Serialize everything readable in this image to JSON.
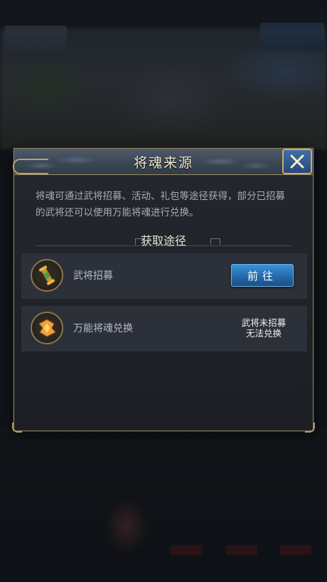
{
  "dialog": {
    "title": "将魂来源",
    "description": "将魂可通过武将招募、活动、礼包等途径获得，部分已招募的武将还可以使用万能将魂进行兑换。",
    "section_title": "获取途径",
    "sources": [
      {
        "label": "武将招募",
        "icon": "scroll-icon",
        "action_label": "前往"
      },
      {
        "label": "万能将魂兑换",
        "icon": "orange-token-icon",
        "status_line1": "武将未招募",
        "status_line2": "无法兑换"
      }
    ]
  },
  "colors": {
    "title_text": "#f0e6cc",
    "button_blue": "#2367a8",
    "frame_gold": "#b39c6a"
  }
}
